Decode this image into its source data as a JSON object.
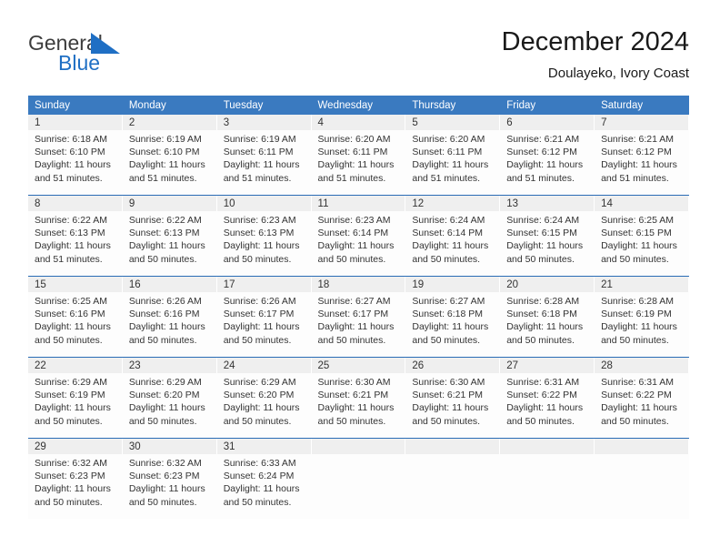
{
  "brand": {
    "name_part1": "General",
    "name_part2": "Blue",
    "flag_icon": "blue-triangle-flag-icon",
    "accent_color": "#1f6fc4"
  },
  "header": {
    "month_title": "December 2024",
    "location": "Doulayeko, Ivory Coast"
  },
  "theme": {
    "header_blue": "#3a7ac0",
    "rule_blue": "#2a6cb5",
    "daynum_band": "#efefef",
    "cell_bg": "#fdfdfd"
  },
  "weekday_headers": [
    "Sunday",
    "Monday",
    "Tuesday",
    "Wednesday",
    "Thursday",
    "Friday",
    "Saturday"
  ],
  "labels": {
    "sunrise_prefix": "Sunrise:",
    "sunset_prefix": "Sunset:",
    "daylight_prefix": "Daylight:"
  },
  "weeks": [
    [
      {
        "day": "1",
        "sunrise": "Sunrise: 6:18 AM",
        "sunset": "Sunset: 6:10 PM",
        "daylight_line1": "Daylight: 11 hours",
        "daylight_line2": "and 51 minutes."
      },
      {
        "day": "2",
        "sunrise": "Sunrise: 6:19 AM",
        "sunset": "Sunset: 6:10 PM",
        "daylight_line1": "Daylight: 11 hours",
        "daylight_line2": "and 51 minutes."
      },
      {
        "day": "3",
        "sunrise": "Sunrise: 6:19 AM",
        "sunset": "Sunset: 6:11 PM",
        "daylight_line1": "Daylight: 11 hours",
        "daylight_line2": "and 51 minutes."
      },
      {
        "day": "4",
        "sunrise": "Sunrise: 6:20 AM",
        "sunset": "Sunset: 6:11 PM",
        "daylight_line1": "Daylight: 11 hours",
        "daylight_line2": "and 51 minutes."
      },
      {
        "day": "5",
        "sunrise": "Sunrise: 6:20 AM",
        "sunset": "Sunset: 6:11 PM",
        "daylight_line1": "Daylight: 11 hours",
        "daylight_line2": "and 51 minutes."
      },
      {
        "day": "6",
        "sunrise": "Sunrise: 6:21 AM",
        "sunset": "Sunset: 6:12 PM",
        "daylight_line1": "Daylight: 11 hours",
        "daylight_line2": "and 51 minutes."
      },
      {
        "day": "7",
        "sunrise": "Sunrise: 6:21 AM",
        "sunset": "Sunset: 6:12 PM",
        "daylight_line1": "Daylight: 11 hours",
        "daylight_line2": "and 51 minutes."
      }
    ],
    [
      {
        "day": "8",
        "sunrise": "Sunrise: 6:22 AM",
        "sunset": "Sunset: 6:13 PM",
        "daylight_line1": "Daylight: 11 hours",
        "daylight_line2": "and 51 minutes."
      },
      {
        "day": "9",
        "sunrise": "Sunrise: 6:22 AM",
        "sunset": "Sunset: 6:13 PM",
        "daylight_line1": "Daylight: 11 hours",
        "daylight_line2": "and 50 minutes."
      },
      {
        "day": "10",
        "sunrise": "Sunrise: 6:23 AM",
        "sunset": "Sunset: 6:13 PM",
        "daylight_line1": "Daylight: 11 hours",
        "daylight_line2": "and 50 minutes."
      },
      {
        "day": "11",
        "sunrise": "Sunrise: 6:23 AM",
        "sunset": "Sunset: 6:14 PM",
        "daylight_line1": "Daylight: 11 hours",
        "daylight_line2": "and 50 minutes."
      },
      {
        "day": "12",
        "sunrise": "Sunrise: 6:24 AM",
        "sunset": "Sunset: 6:14 PM",
        "daylight_line1": "Daylight: 11 hours",
        "daylight_line2": "and 50 minutes."
      },
      {
        "day": "13",
        "sunrise": "Sunrise: 6:24 AM",
        "sunset": "Sunset: 6:15 PM",
        "daylight_line1": "Daylight: 11 hours",
        "daylight_line2": "and 50 minutes."
      },
      {
        "day": "14",
        "sunrise": "Sunrise: 6:25 AM",
        "sunset": "Sunset: 6:15 PM",
        "daylight_line1": "Daylight: 11 hours",
        "daylight_line2": "and 50 minutes."
      }
    ],
    [
      {
        "day": "15",
        "sunrise": "Sunrise: 6:25 AM",
        "sunset": "Sunset: 6:16 PM",
        "daylight_line1": "Daylight: 11 hours",
        "daylight_line2": "and 50 minutes."
      },
      {
        "day": "16",
        "sunrise": "Sunrise: 6:26 AM",
        "sunset": "Sunset: 6:16 PM",
        "daylight_line1": "Daylight: 11 hours",
        "daylight_line2": "and 50 minutes."
      },
      {
        "day": "17",
        "sunrise": "Sunrise: 6:26 AM",
        "sunset": "Sunset: 6:17 PM",
        "daylight_line1": "Daylight: 11 hours",
        "daylight_line2": "and 50 minutes."
      },
      {
        "day": "18",
        "sunrise": "Sunrise: 6:27 AM",
        "sunset": "Sunset: 6:17 PM",
        "daylight_line1": "Daylight: 11 hours",
        "daylight_line2": "and 50 minutes."
      },
      {
        "day": "19",
        "sunrise": "Sunrise: 6:27 AM",
        "sunset": "Sunset: 6:18 PM",
        "daylight_line1": "Daylight: 11 hours",
        "daylight_line2": "and 50 minutes."
      },
      {
        "day": "20",
        "sunrise": "Sunrise: 6:28 AM",
        "sunset": "Sunset: 6:18 PM",
        "daylight_line1": "Daylight: 11 hours",
        "daylight_line2": "and 50 minutes."
      },
      {
        "day": "21",
        "sunrise": "Sunrise: 6:28 AM",
        "sunset": "Sunset: 6:19 PM",
        "daylight_line1": "Daylight: 11 hours",
        "daylight_line2": "and 50 minutes."
      }
    ],
    [
      {
        "day": "22",
        "sunrise": "Sunrise: 6:29 AM",
        "sunset": "Sunset: 6:19 PM",
        "daylight_line1": "Daylight: 11 hours",
        "daylight_line2": "and 50 minutes."
      },
      {
        "day": "23",
        "sunrise": "Sunrise: 6:29 AM",
        "sunset": "Sunset: 6:20 PM",
        "daylight_line1": "Daylight: 11 hours",
        "daylight_line2": "and 50 minutes."
      },
      {
        "day": "24",
        "sunrise": "Sunrise: 6:29 AM",
        "sunset": "Sunset: 6:20 PM",
        "daylight_line1": "Daylight: 11 hours",
        "daylight_line2": "and 50 minutes."
      },
      {
        "day": "25",
        "sunrise": "Sunrise: 6:30 AM",
        "sunset": "Sunset: 6:21 PM",
        "daylight_line1": "Daylight: 11 hours",
        "daylight_line2": "and 50 minutes."
      },
      {
        "day": "26",
        "sunrise": "Sunrise: 6:30 AM",
        "sunset": "Sunset: 6:21 PM",
        "daylight_line1": "Daylight: 11 hours",
        "daylight_line2": "and 50 minutes."
      },
      {
        "day": "27",
        "sunrise": "Sunrise: 6:31 AM",
        "sunset": "Sunset: 6:22 PM",
        "daylight_line1": "Daylight: 11 hours",
        "daylight_line2": "and 50 minutes."
      },
      {
        "day": "28",
        "sunrise": "Sunrise: 6:31 AM",
        "sunset": "Sunset: 6:22 PM",
        "daylight_line1": "Daylight: 11 hours",
        "daylight_line2": "and 50 minutes."
      }
    ],
    [
      {
        "day": "29",
        "sunrise": "Sunrise: 6:32 AM",
        "sunset": "Sunset: 6:23 PM",
        "daylight_line1": "Daylight: 11 hours",
        "daylight_line2": "and 50 minutes."
      },
      {
        "day": "30",
        "sunrise": "Sunrise: 6:32 AM",
        "sunset": "Sunset: 6:23 PM",
        "daylight_line1": "Daylight: 11 hours",
        "daylight_line2": "and 50 minutes."
      },
      {
        "day": "31",
        "sunrise": "Sunrise: 6:33 AM",
        "sunset": "Sunset: 6:24 PM",
        "daylight_line1": "Daylight: 11 hours",
        "daylight_line2": "and 50 minutes."
      },
      {
        "day": "",
        "sunrise": "",
        "sunset": "",
        "daylight_line1": "",
        "daylight_line2": ""
      },
      {
        "day": "",
        "sunrise": "",
        "sunset": "",
        "daylight_line1": "",
        "daylight_line2": ""
      },
      {
        "day": "",
        "sunrise": "",
        "sunset": "",
        "daylight_line1": "",
        "daylight_line2": ""
      },
      {
        "day": "",
        "sunrise": "",
        "sunset": "",
        "daylight_line1": "",
        "daylight_line2": ""
      }
    ]
  ]
}
